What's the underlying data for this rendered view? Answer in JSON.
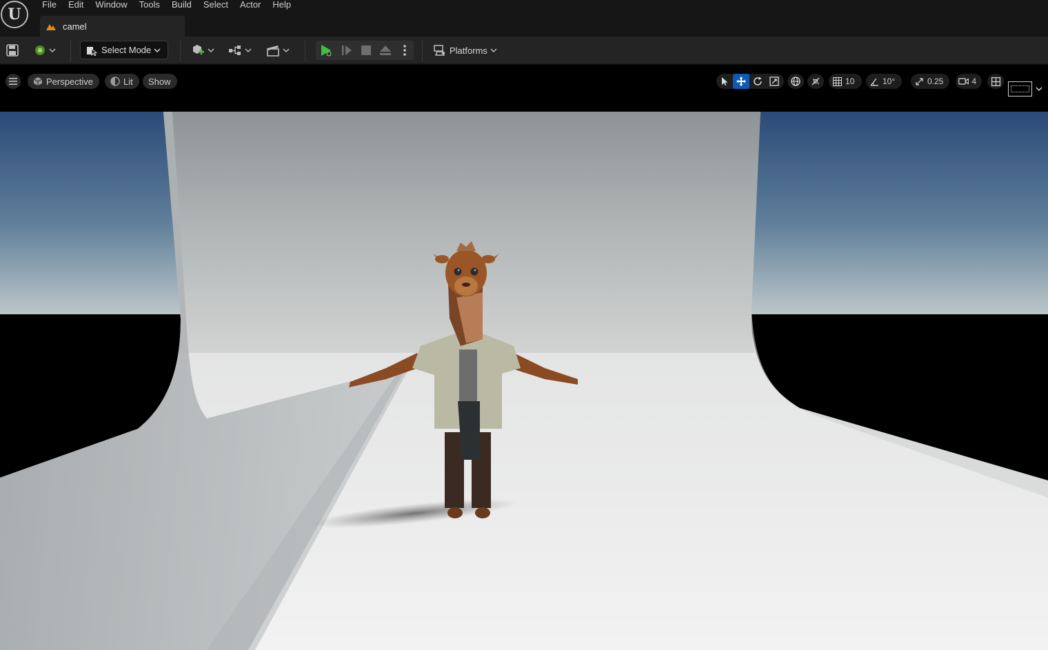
{
  "menu": [
    "File",
    "Edit",
    "Window",
    "Tools",
    "Build",
    "Select",
    "Actor",
    "Help"
  ],
  "tab": {
    "title": "camel"
  },
  "toolbar": {
    "select_mode_label": "Select Mode",
    "platforms_label": "Platforms"
  },
  "viewport_toolbar": {
    "view_mode": "Perspective",
    "lighting": "Lit",
    "show": "Show",
    "grid_snap": "10",
    "rotation_snap": "10°",
    "scale_snap": "0.25",
    "camera_speed": "4"
  },
  "colors": {
    "accent_blue": "#0f5ab6",
    "play_green": "#3fbf3f",
    "level_orange": "#e08a1e",
    "sky_top": "#2c4d7c",
    "sky_horizon": "#b9c3c6"
  }
}
